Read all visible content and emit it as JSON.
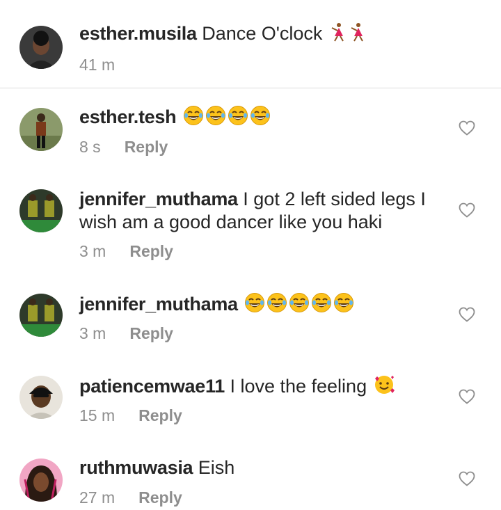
{
  "caption": {
    "username": "esther.musila",
    "text": "Dance O'clock",
    "emoji": [
      "dancer-emoji",
      "dancer-emoji"
    ],
    "time": "41 m"
  },
  "comments": [
    {
      "username": "esther.tesh",
      "text": "",
      "emoji": [
        "laugh-emoji",
        "laugh-emoji",
        "laugh-emoji",
        "laugh-emoji"
      ],
      "time": "8 s",
      "reply": "Reply"
    },
    {
      "username": "jennifer_muthama",
      "text": "I got 2 left sided legs I wish am a good dancer like you haki",
      "emoji": [],
      "time": "3 m",
      "reply": "Reply"
    },
    {
      "username": "jennifer_muthama",
      "text": "",
      "emoji": [
        "laugh-emoji",
        "laugh-emoji",
        "laugh-emoji",
        "laugh-emoji",
        "laugh-emoji"
      ],
      "time": "3 m",
      "reply": "Reply"
    },
    {
      "username": "patiencemwae11",
      "text": "I love the feeling",
      "emoji": [
        "smiling-hearts-emoji"
      ],
      "time": "15 m",
      "reply": "Reply"
    },
    {
      "username": "ruthmuwasia",
      "text": "Eish",
      "emoji": [],
      "time": "27 m",
      "reply": "Reply"
    }
  ],
  "colors": {
    "text": "#262626",
    "meta": "#8e8e8e",
    "divider": "#dbdbdb",
    "emoji_face": "#fcc21b"
  }
}
